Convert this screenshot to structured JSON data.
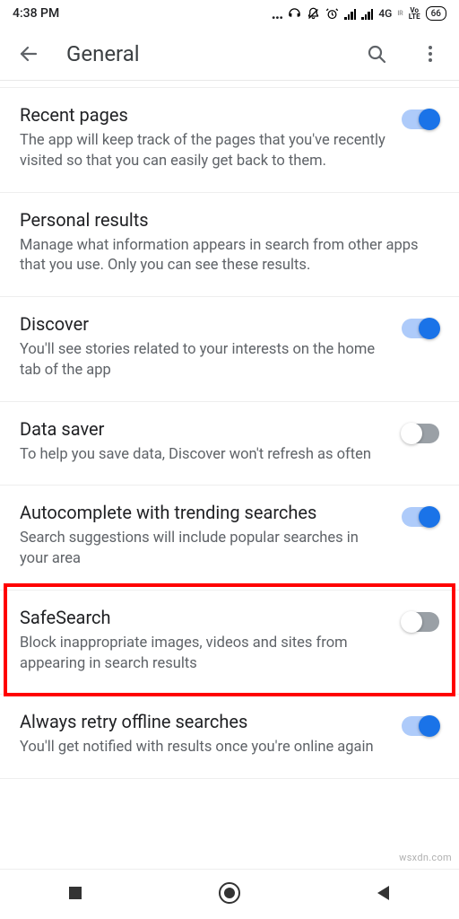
{
  "statusbar": {
    "time": "4:38 PM",
    "network_label": "4G",
    "volte": "Vo\nLTE",
    "battery": "66"
  },
  "header": {
    "title": "General"
  },
  "settings": [
    {
      "title": "Recent pages",
      "desc": "The app will keep track of the pages that you've recently visited so that you can easily get back to them.",
      "toggle": true,
      "has_toggle": true
    },
    {
      "title": "Personal results",
      "desc": "Manage what information appears in search from other apps that you use. Only you can see these results.",
      "has_toggle": false
    },
    {
      "title": "Discover",
      "desc": "You'll see stories related to your interests on the home tab of the app",
      "toggle": true,
      "has_toggle": true
    },
    {
      "title": "Data saver",
      "desc": "To help you save data, Discover won't refresh as often",
      "toggle": false,
      "has_toggle": true
    },
    {
      "title": "Autocomplete with trending searches",
      "desc": "Search suggestions will include popular searches in your area",
      "toggle": true,
      "has_toggle": true
    },
    {
      "title": "SafeSearch",
      "desc": "Block inappropriate images, videos and sites from appearing in search results",
      "toggle": false,
      "has_toggle": true
    },
    {
      "title": "Always retry offline searches",
      "desc": "You'll get notified with results once you're online again",
      "toggle": true,
      "has_toggle": true
    }
  ],
  "watermark": "wsxdn.com"
}
